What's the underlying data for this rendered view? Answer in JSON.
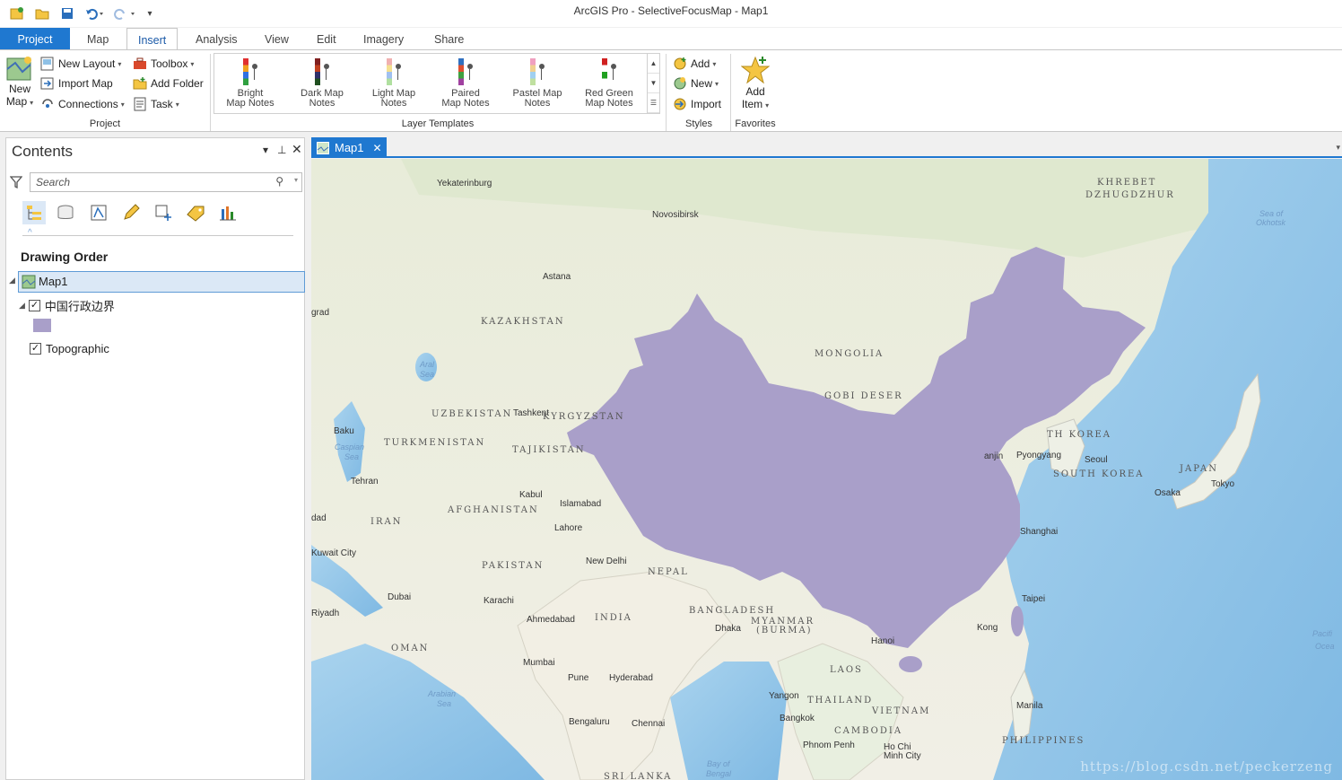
{
  "app": {
    "title": "ArcGIS Pro - SelectiveFocusMap - Map1"
  },
  "tabs": [
    {
      "label": "Project"
    },
    {
      "label": "Map"
    },
    {
      "label": "Insert"
    },
    {
      "label": "Analysis"
    },
    {
      "label": "View"
    },
    {
      "label": "Edit"
    },
    {
      "label": "Imagery"
    },
    {
      "label": "Share"
    }
  ],
  "ribbon": {
    "project_group": {
      "label": "Project",
      "new_map": "New",
      "new_map_line2": "Map",
      "new_layout": "New Layout",
      "import_map": "Import Map",
      "connections": "Connections",
      "toolbox": "Toolbox",
      "add_folder": "Add Folder",
      "task": "Task"
    },
    "layer_templates": {
      "label": "Layer Templates",
      "items": [
        {
          "line1": "Bright",
          "line2": "Map Notes",
          "colors": [
            "#e03030",
            "#f0a020",
            "#3070e0",
            "#30a040"
          ]
        },
        {
          "line1": "Dark Map",
          "line2": "Notes",
          "colors": [
            "#802020",
            "#c04020",
            "#30306a",
            "#205020"
          ]
        },
        {
          "line1": "Light Map",
          "line2": "Notes",
          "colors": [
            "#f0b0b0",
            "#f5e090",
            "#a0c0f0",
            "#b0e0a0"
          ]
        },
        {
          "line1": "Paired",
          "line2": "Map Notes",
          "colors": [
            "#3070c0",
            "#e05030",
            "#40a040",
            "#a040a0"
          ]
        },
        {
          "line1": "Pastel Map",
          "line2": "Notes",
          "colors": [
            "#f0a0c0",
            "#f0d090",
            "#a0d0f0",
            "#c0e0a0"
          ]
        },
        {
          "line1": "Red Green",
          "line2": "Map Notes",
          "colors": [
            "#d02020",
            "#ffffff",
            "#20a020",
            "#ffffff"
          ]
        }
      ]
    },
    "styles": {
      "label": "Styles",
      "add": "Add",
      "new": "New",
      "import": "Import"
    },
    "favorites": {
      "label": "Favorites",
      "add_item": "Add",
      "add_item_line2": "Item"
    }
  },
  "contents": {
    "title": "Contents",
    "search_placeholder": "Search",
    "drawing_order": "Drawing Order",
    "map_name": "Map1",
    "layer1": "中国行政边界",
    "layer1_swatch": "#a99fc9",
    "layer2": "Topographic"
  },
  "map_tab": {
    "label": "Map1"
  },
  "map": {
    "places": [
      {
        "t": "Yekaterinburg"
      },
      {
        "t": "Novosibirsk"
      },
      {
        "t": "Astana"
      },
      {
        "t": "Baku"
      },
      {
        "t": "Tehran"
      },
      {
        "t": "Tashkent"
      },
      {
        "t": "Kabul"
      },
      {
        "t": "Islamabad"
      },
      {
        "t": "Lahore"
      },
      {
        "t": "New Delhi"
      },
      {
        "t": "Karachi"
      },
      {
        "t": "Ahmedabad"
      },
      {
        "t": "Mumbai"
      },
      {
        "t": "Pune"
      },
      {
        "t": "Hyderabad"
      },
      {
        "t": "Bengaluru"
      },
      {
        "t": "Chennai"
      },
      {
        "t": "Dhaka"
      },
      {
        "t": "Yangon"
      },
      {
        "t": "Bangkok"
      },
      {
        "t": "Phnom Penh"
      },
      {
        "t": "Ho Chi"
      },
      {
        "t": "Minh City"
      },
      {
        "t": "Manila"
      },
      {
        "t": "Taipei"
      },
      {
        "t": "Shanghai"
      },
      {
        "t": "Pyongyang"
      },
      {
        "t": "Seoul"
      },
      {
        "t": "Osaka"
      },
      {
        "t": "Tokyo"
      },
      {
        "t": "Dubai"
      },
      {
        "t": "Riyadh"
      },
      {
        "t": "Kuwait City"
      },
      {
        "t": "grad"
      },
      {
        "t": "dad"
      },
      {
        "t": "Kong"
      },
      {
        "t": "Hanoi"
      },
      {
        "t": "anjin"
      }
    ],
    "countries": [
      {
        "t": "KAZAKHSTAN"
      },
      {
        "t": "MONGOLIA"
      },
      {
        "t": "UZBEKISTAN"
      },
      {
        "t": "KYRGYZSTAN"
      },
      {
        "t": "TURKMENISTAN"
      },
      {
        "t": "TAJIKISTAN"
      },
      {
        "t": "AFGHANISTAN"
      },
      {
        "t": "IRAN"
      },
      {
        "t": "PAKISTAN"
      },
      {
        "t": "INDIA"
      },
      {
        "t": "NEPAL"
      },
      {
        "t": "BANGLADESH"
      },
      {
        "t": "MYANMAR"
      },
      {
        "t": "(BURMA)"
      },
      {
        "t": "LAOS"
      },
      {
        "t": "THAILAND"
      },
      {
        "t": "VIETNAM"
      },
      {
        "t": "CAMBODIA"
      },
      {
        "t": "PHILIPPINES"
      },
      {
        "t": "SOUTH KOREA"
      },
      {
        "t": "JAPAN"
      },
      {
        "t": "OMAN"
      },
      {
        "t": "GOBI DESER"
      },
      {
        "t": "KHREBET"
      },
      {
        "t": "DZHUGDZHUR"
      },
      {
        "t": "TH KOREA"
      },
      {
        "t": "SRI LANKA"
      }
    ],
    "water": [
      {
        "t": "Caspian"
      },
      {
        "t": "Sea"
      },
      {
        "t": "Arabian"
      },
      {
        "t": "Sea"
      },
      {
        "t": "Bay of"
      },
      {
        "t": "Bengal"
      },
      {
        "t": "Sea of"
      },
      {
        "t": "Okhotsk"
      },
      {
        "t": "Pacifi"
      },
      {
        "t": "Ocea"
      },
      {
        "t": "Aral"
      },
      {
        "t": "Sea"
      }
    ],
    "highlight_color": "#a99fc9",
    "watermark": "https://blog.csdn.net/peckerzeng"
  }
}
